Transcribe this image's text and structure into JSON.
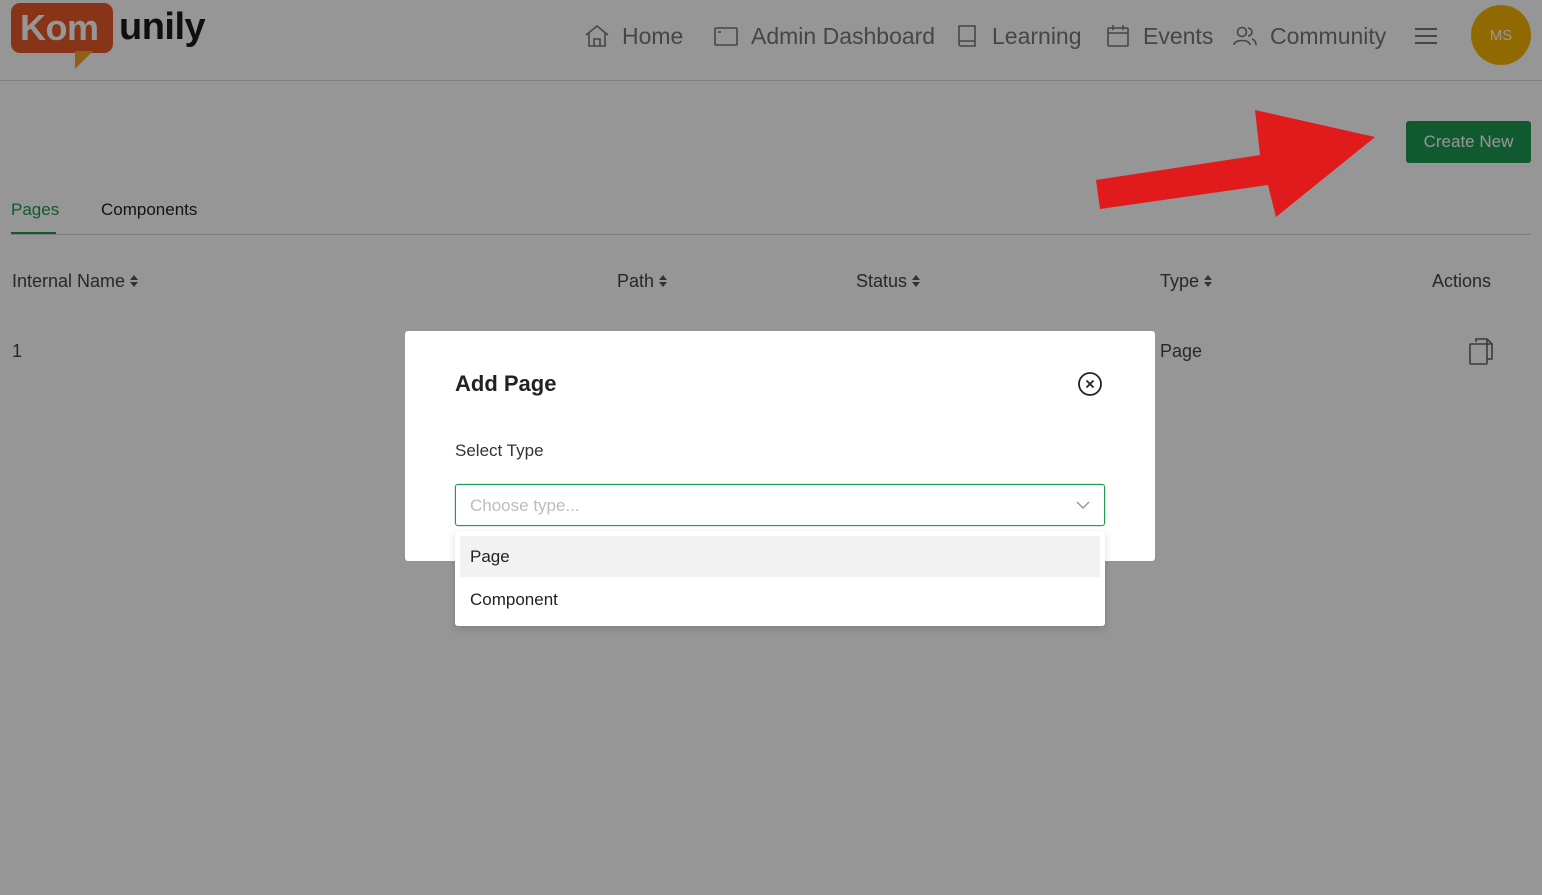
{
  "brand": {
    "logo_part1": "Kom",
    "logo_part2": "unily"
  },
  "nav": {
    "home": "Home",
    "admin": "Admin Dashboard",
    "learning": "Learning",
    "events": "Events",
    "community": "Community"
  },
  "user": {
    "initials": "MS"
  },
  "toolbar": {
    "create_label": "Create New"
  },
  "tabs": [
    {
      "label": "Pages"
    },
    {
      "label": "Components"
    }
  ],
  "table": {
    "headers": [
      "Internal Name",
      "Path",
      "Status",
      "Type",
      "Actions"
    ],
    "rows": [
      {
        "internal_name": "1",
        "type": "Page"
      }
    ]
  },
  "modal": {
    "title": "Add Page",
    "field_label": "Select Type",
    "placeholder": "Choose type...",
    "options": [
      "Page",
      "Component"
    ]
  },
  "colors": {
    "accent": "#1d9a50",
    "logo": "#e8592a",
    "avatar": "#f5b400",
    "arrow": "#e11b1b"
  }
}
